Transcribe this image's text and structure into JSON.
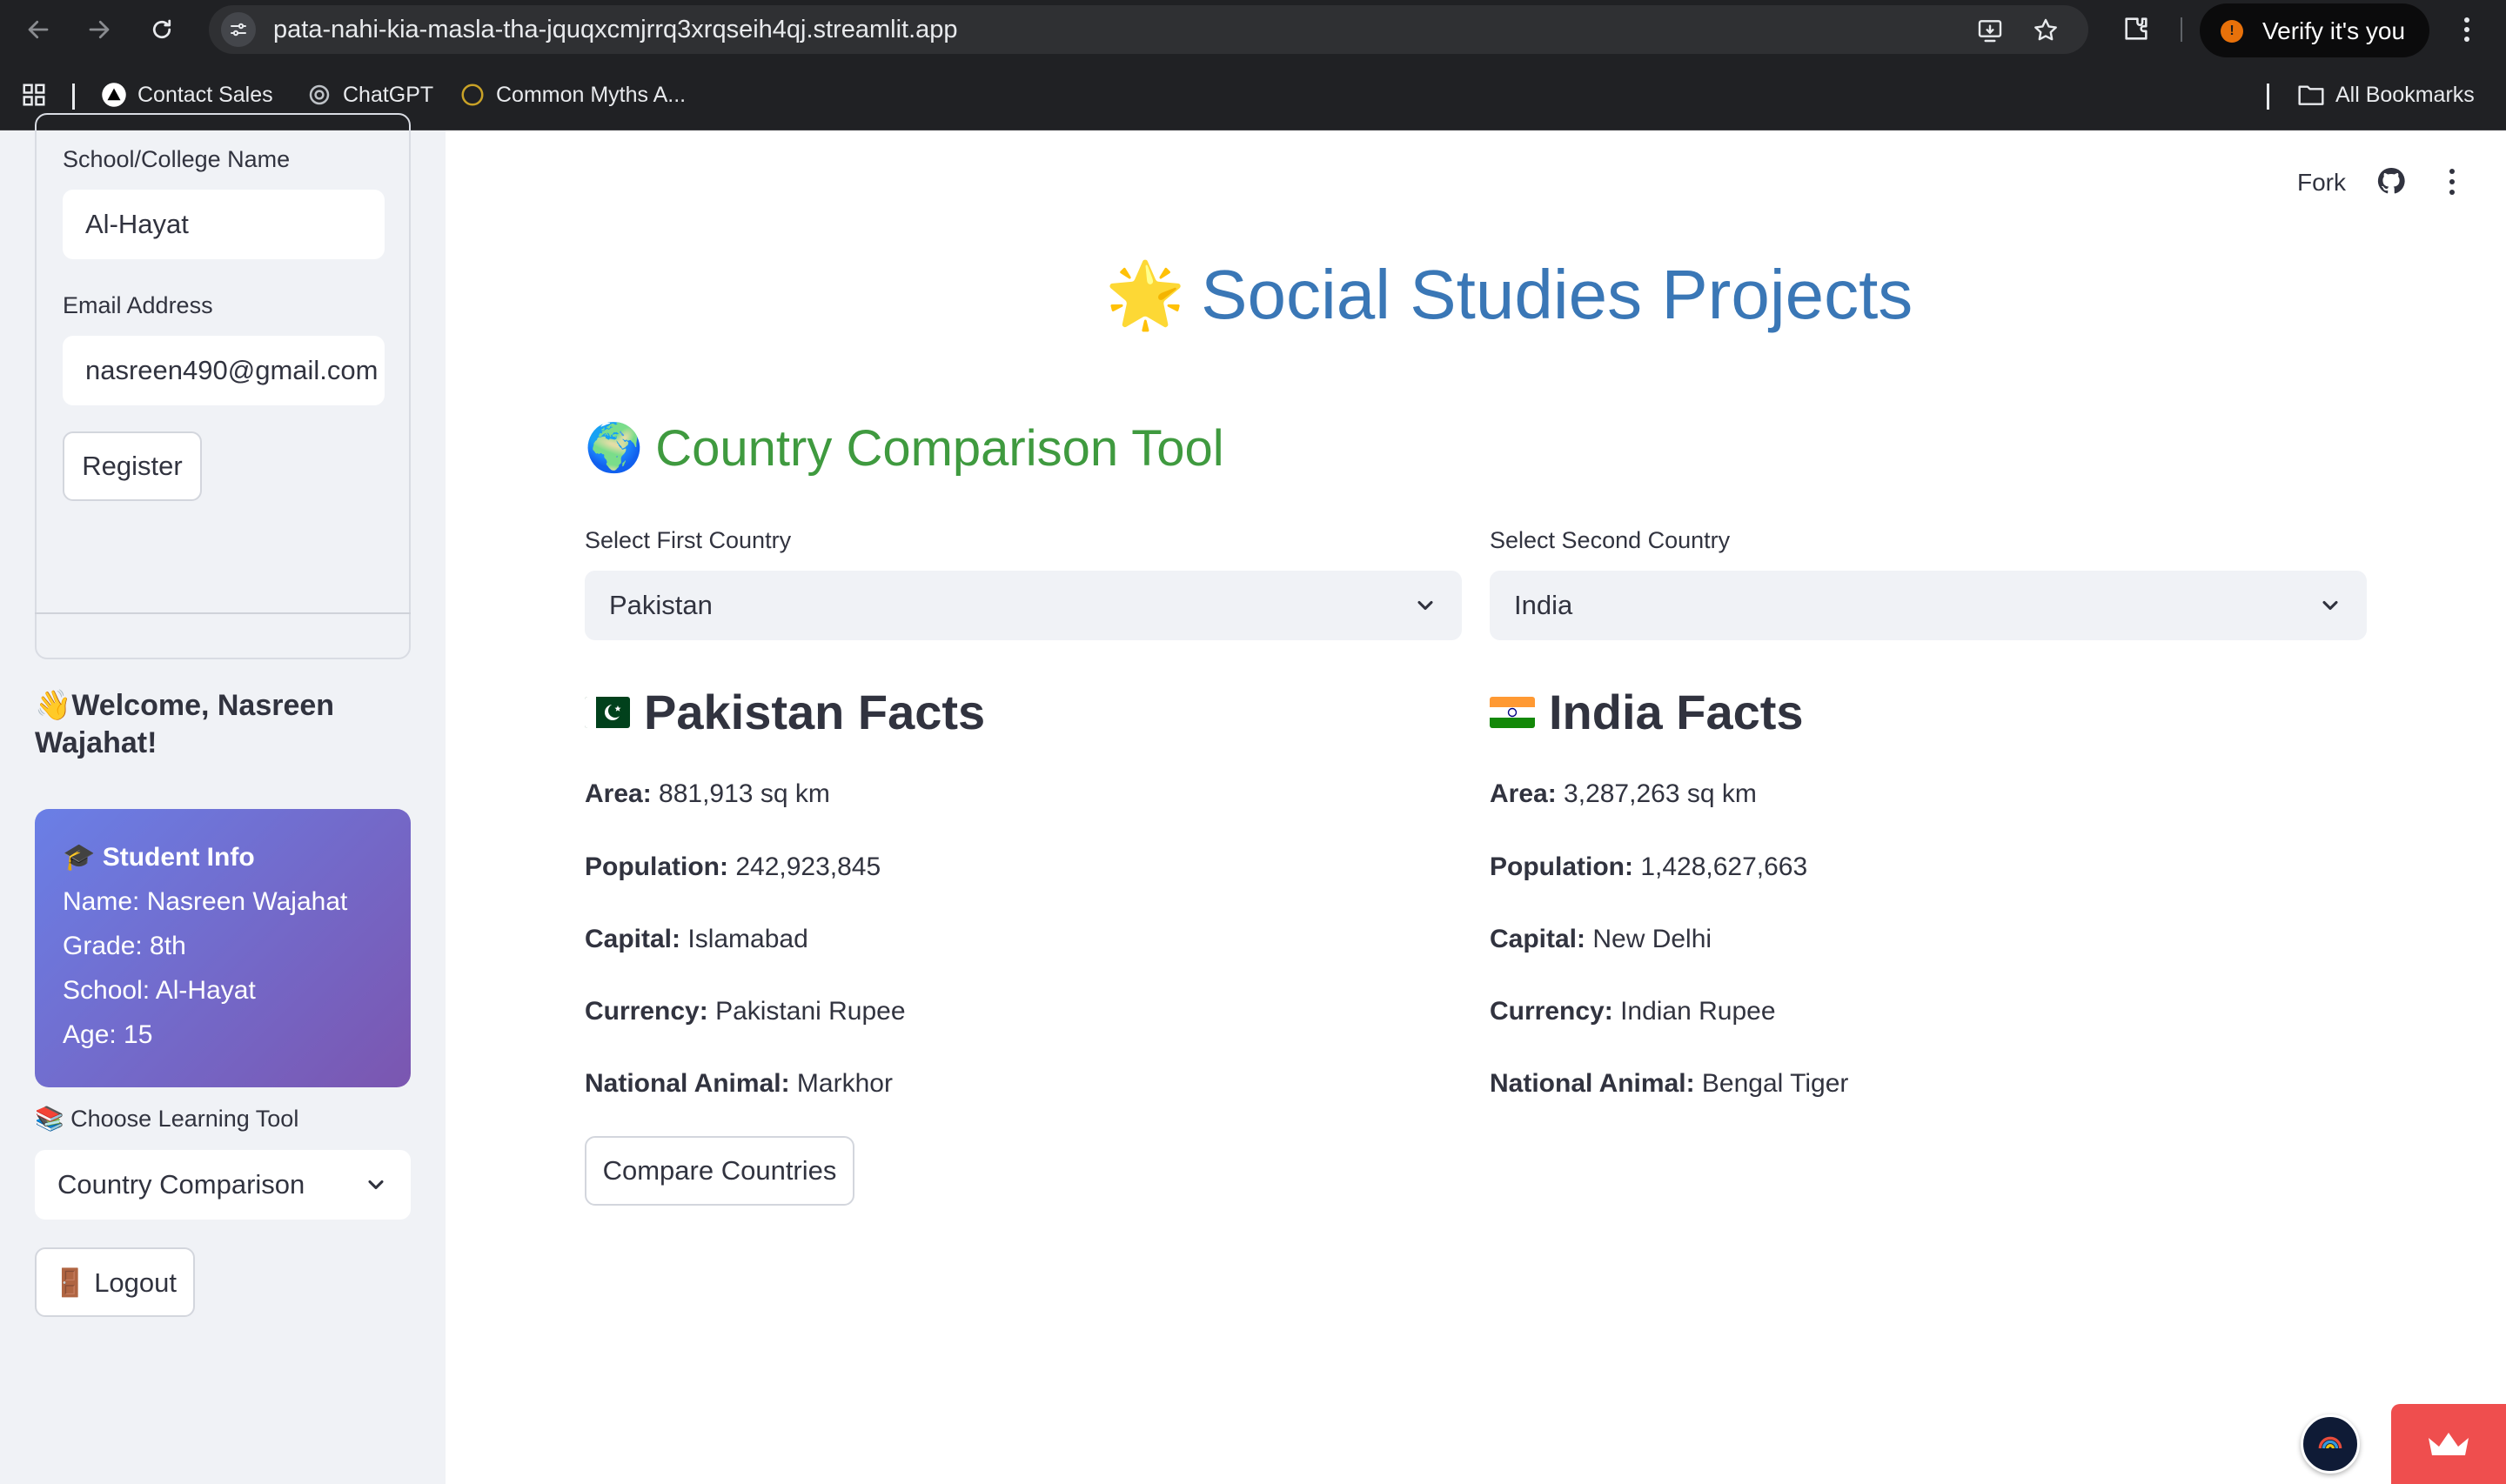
{
  "browser": {
    "url": "pata-nahi-kia-masla-tha-jquqxcmjrrq3xrqseih4qj.streamlit.app",
    "profile_label": "Verify it's you",
    "profile_initial": "!",
    "bookmarks": [
      {
        "label": "Contact Sales",
        "icon": "triangle-logo-icon"
      },
      {
        "label": "ChatGPT",
        "icon": "openai-logo-icon"
      },
      {
        "label": "Common Myths A...",
        "icon": "circle-logo-icon"
      }
    ],
    "all_bookmarks_label": "All Bookmarks"
  },
  "sidebar": {
    "school_label": "School/College Name",
    "school_value": "Al-Hayat",
    "email_label": "Email Address",
    "email_value": "nasreen490@gmail.com",
    "register_label": "Register",
    "welcome_text": "👋Welcome, Nasreen Wajahat!",
    "info_card": {
      "title": "🎓 Student Info",
      "name": "Name: Nasreen Wajahat",
      "grade": "Grade: 8th",
      "school": "School: Al-Hayat",
      "age": "Age: 15"
    },
    "tool_label": "📚 Choose Learning Tool",
    "tool_value": "Country Comparison",
    "logout_label": "🚪 Logout"
  },
  "header": {
    "fork_label": "Fork"
  },
  "main": {
    "page_title_emoji": "🌟",
    "page_title": "Social Studies Projects",
    "section_emoji": "🌍",
    "section_title": "Country Comparison Tool",
    "first_label": "Select First Country",
    "first_value": "Pakistan",
    "second_label": "Select Second Country",
    "second_value": "India",
    "country1": {
      "heading": "Pakistan Facts",
      "area_label": "Area:",
      "area": "881,913 sq km",
      "population_label": "Population:",
      "population": "242,923,845",
      "capital_label": "Capital:",
      "capital": "Islamabad",
      "currency_label": "Currency:",
      "currency": "Pakistani Rupee",
      "animal_label": "National Animal:",
      "animal": "Markhor"
    },
    "country2": {
      "heading": "India Facts",
      "area_label": "Area:",
      "area": "3,287,263 sq km",
      "population_label": "Population:",
      "population": "1,428,627,663",
      "capital_label": "Capital:",
      "capital": "New Delhi",
      "currency_label": "Currency:",
      "currency": "Indian Rupee",
      "animal_label": "National Animal:",
      "animal": "Bengal Tiger"
    },
    "compare_label": "Compare Countries"
  },
  "colors": {
    "title_blue": "#3a77b6",
    "section_green": "#3f9a3f",
    "card_gradient_start": "#6a7fe6",
    "card_gradient_end": "#7b56b0",
    "streamlit_red": "#ef4e4e"
  }
}
